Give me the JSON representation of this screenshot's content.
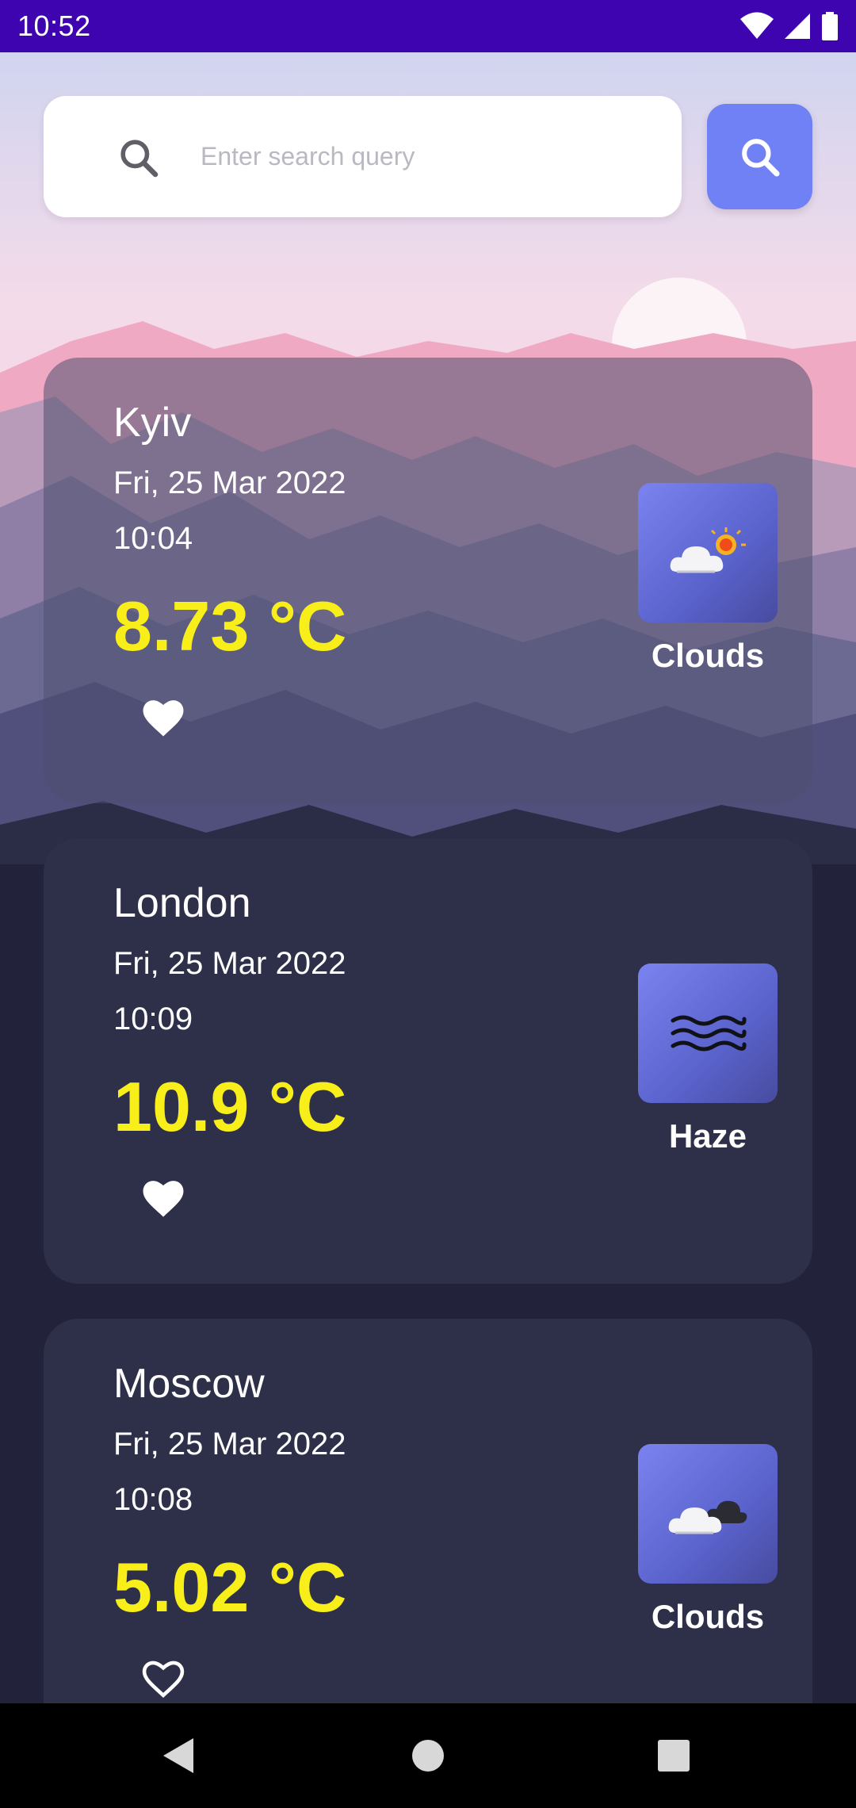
{
  "status_bar": {
    "time": "10:52"
  },
  "search": {
    "placeholder": "Enter search query"
  },
  "cards": [
    {
      "city": "Kyiv",
      "date": "Fri, 25 Mar 2022",
      "time": "10:04",
      "temperature": "8.73 °C",
      "condition": "Clouds",
      "favorite": true,
      "icon": "cloud-sun-icon"
    },
    {
      "city": "London",
      "date": "Fri, 25 Mar 2022",
      "time": "10:09",
      "temperature": "10.9 °C",
      "condition": "Haze",
      "favorite": true,
      "icon": "haze-icon"
    },
    {
      "city": "Moscow",
      "date": "Fri, 25 Mar 2022",
      "time": "10:08",
      "temperature": "5.02 °C",
      "condition": "Clouds",
      "favorite": false,
      "icon": "cloud-dark-icon"
    }
  ],
  "colors": {
    "status_bar": "#3e04b0",
    "accent": "#7081f5",
    "temperature": "#f8ee1a",
    "card": "#2e3049",
    "background": "#22233a"
  }
}
